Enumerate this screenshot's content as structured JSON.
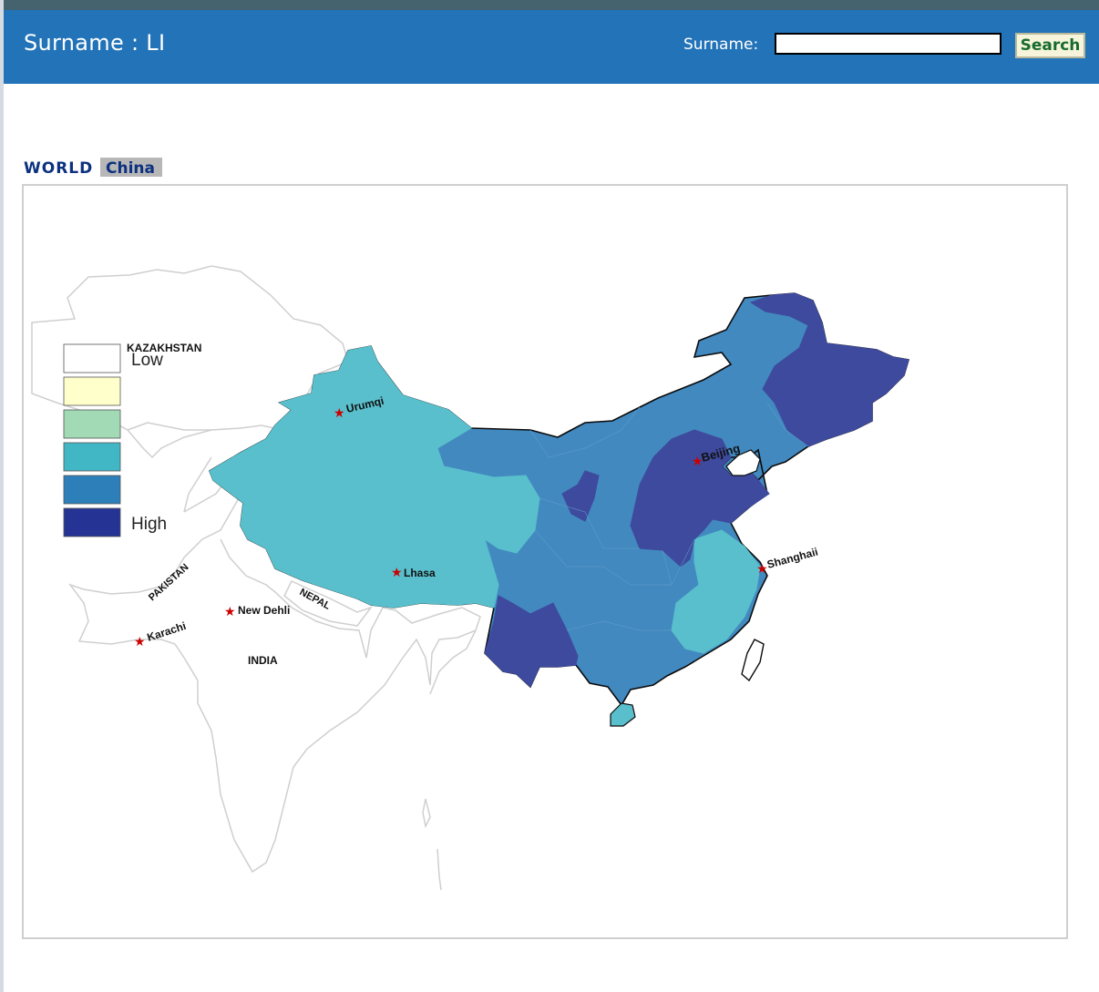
{
  "header": {
    "title": "Surname : LI",
    "search_label": "Surname:",
    "search_value": "",
    "search_button": "Search"
  },
  "tabs": {
    "world": "WORLD",
    "china": "China"
  },
  "legend": {
    "low_label": "Low",
    "high_label": "High"
  },
  "map_labels": {
    "kazakhstan": "KAZAKHSTAN",
    "pakistan": "PAKISTAN",
    "nepal": "NEPAL",
    "india": "INDIA"
  },
  "cities": {
    "urumqi": "Urumqi",
    "beijing": "Beijing",
    "shanghai": "Shanghaii",
    "lhasa": "Lhasa",
    "new_delhi": "New Dehli",
    "karachi": "Karachi"
  },
  "colors": {
    "header": "#2273b8",
    "level_1": "#ffffff",
    "level_2": "#ffffcc",
    "level_3": "#a1dab4",
    "level_4": "#41b6c4",
    "level_5": "#2c7fb8",
    "level_6": "#253494",
    "city_marker": "#cc0000"
  }
}
